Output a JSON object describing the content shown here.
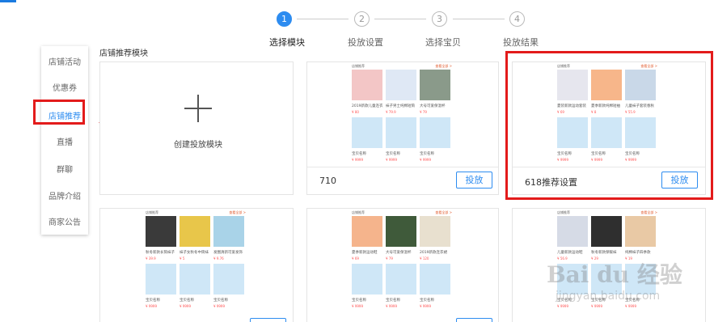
{
  "steps": [
    {
      "num": "1",
      "label": "选择模块",
      "active": true
    },
    {
      "num": "2",
      "label": "投放设置",
      "active": false
    },
    {
      "num": "3",
      "label": "选择宝贝",
      "active": false
    },
    {
      "num": "4",
      "label": "投放结果",
      "active": false
    }
  ],
  "sidebar": {
    "items": [
      {
        "label": "店铺活动"
      },
      {
        "label": "优惠券"
      },
      {
        "label": "店铺推荐"
      },
      {
        "label": "直播"
      },
      {
        "label": "群聊"
      },
      {
        "label": "品牌介绍"
      },
      {
        "label": "商家公告"
      }
    ]
  },
  "section_title": "店铺推荐模块",
  "create_card": {
    "label": "创建投放模块"
  },
  "cards": [
    {
      "name": "710",
      "button": "投放",
      "preview": {
        "head_l": "店铺推荐",
        "head_r": "查看全部 >",
        "names": [
          "2019新款儿童连衣",
          "袜子男士纯棉短筒",
          "大号可爱保温杯"
        ],
        "prices": [
          "¥ 80",
          "¥ 79.9",
          "¥ 79"
        ],
        "placeholder_names": [
          "宝贝名称",
          "宝贝名称",
          "宝贝名称"
        ],
        "placeholder_prices": [
          "¥ 9999",
          "¥ 9999",
          "¥ 9999"
        ]
      }
    },
    {
      "name": "618推荐设置",
      "button": "投放",
      "preview": {
        "head_l": "店铺推荐",
        "head_r": "查看全部 >",
        "names": [
          "夏装新款运动套装",
          "夏季新款纯棉短袖",
          "儿童袜子套装春秋"
        ],
        "prices": [
          "¥ 69",
          "¥ 8",
          "¥ 55.9"
        ],
        "placeholder_names": [
          "宝贝名称",
          "宝贝名称",
          "宝贝名称"
        ],
        "placeholder_prices": [
          "¥ 9999",
          "¥ 9999",
          "¥ 9999"
        ]
      }
    },
    {
      "preview": {
        "head_l": "店铺推荐",
        "head_r": "查看全部 >",
        "names": [
          "秋冬新款长筒袜子",
          "袜子女秋冬中筒袜",
          "发圈清新可爱发饰"
        ],
        "prices": [
          "¥ 39.9",
          "¥ 5",
          "¥ 9.76"
        ],
        "placeholder_names": [
          "宝贝名称",
          "宝贝名称",
          "宝贝名称"
        ],
        "placeholder_prices": [
          "¥ 9999",
          "¥ 9999",
          "¥ 9999"
        ]
      }
    },
    {
      "preview": {
        "head_l": "店铺推荐",
        "head_r": "查看全部 >",
        "names": [
          "夏季新款运动鞋",
          "大号可爱保温杯",
          "2019新款连衣裙"
        ],
        "prices": [
          "¥ 69",
          "¥ 79",
          "¥ 120"
        ],
        "placeholder_names": [
          "宝贝名称",
          "宝贝名称",
          "宝贝名称"
        ],
        "placeholder_prices": [
          "¥ 9999",
          "¥ 9999",
          "¥ 9999"
        ]
      }
    },
    {
      "preview": {
        "head_l": "店铺推荐",
        "head_r": "查看全部 >",
        "names": [
          "儿童新款运动鞋",
          "秋冬新款保暖袜",
          "纯棉袜子四季款"
        ],
        "prices": [
          "¥ 56.9",
          "¥ 29",
          "¥ 19"
        ],
        "placeholder_names": [
          "宝贝名称",
          "宝贝名称",
          "宝贝名称"
        ],
        "placeholder_prices": [
          "¥ 9999",
          "¥ 9999",
          "¥ 9999"
        ]
      }
    }
  ],
  "watermark": {
    "main": "Bai du 经验",
    "sub": "jingyan.baidu.com"
  },
  "colors": {
    "accent": "#2d8cf0",
    "highlight": "#e31b1b",
    "placeholder_tile": "#cfe7f7"
  }
}
